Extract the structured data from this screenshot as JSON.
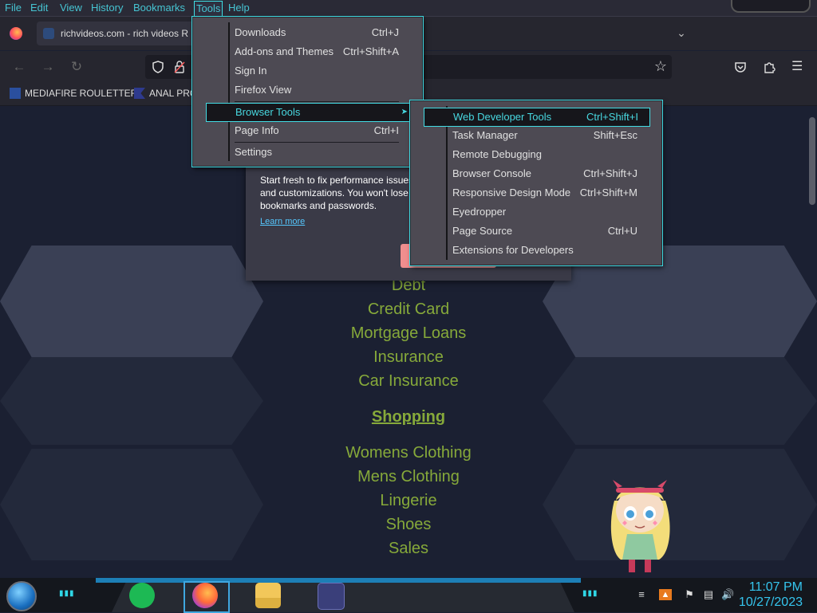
{
  "menubar": {
    "items": [
      "File",
      "Edit",
      "View",
      "History",
      "Bookmarks",
      "Tools",
      "Help"
    ]
  },
  "tab": {
    "title": "richvideos.com - rich videos R"
  },
  "bookmarks": [
    {
      "label": "MEDIAFIRE ROULETTER",
      "icon": "mediafire-icon"
    },
    {
      "label": "ANAL PRO",
      "icon": "bookmark-icon"
    }
  ],
  "popup": {
    "text": "Start fresh to fix performance issues and customizations. You won't lose bookmarks and passwords.",
    "link": "Learn more"
  },
  "tools_menu": {
    "items": [
      {
        "label": "Downloads",
        "shortcut": "Ctrl+J"
      },
      {
        "label": "Add-ons and Themes",
        "shortcut": "Ctrl+Shift+A"
      },
      {
        "label": "Sign In",
        "shortcut": ""
      },
      {
        "label": "Firefox View",
        "shortcut": ""
      },
      {
        "label": "Browser Tools",
        "shortcut": ""
      },
      {
        "label": "Page Info",
        "shortcut": "Ctrl+I"
      },
      {
        "label": "Settings",
        "shortcut": ""
      }
    ]
  },
  "browser_tools_menu": {
    "items": [
      {
        "label": "Web Developer Tools",
        "shortcut": "Ctrl+Shift+I"
      },
      {
        "label": "Task Manager",
        "shortcut": "Shift+Esc"
      },
      {
        "label": "Remote Debugging",
        "shortcut": ""
      },
      {
        "label": "Browser Console",
        "shortcut": "Ctrl+Shift+J"
      },
      {
        "label": "Responsive Design Mode",
        "shortcut": "Ctrl+Shift+M"
      },
      {
        "label": "Eyedropper",
        "shortcut": ""
      },
      {
        "label": "Page Source",
        "shortcut": "Ctrl+U"
      },
      {
        "label": "Extensions for Developers",
        "shortcut": ""
      }
    ]
  },
  "content": {
    "links_top": [
      "Debt",
      "Credit Card",
      "Mortgage Loans",
      "Insurance",
      "Car Insurance"
    ],
    "heading": "Shopping",
    "links_bottom": [
      "Womens Clothing",
      "Mens Clothing",
      "Lingerie",
      "Shoes",
      "Sales"
    ]
  },
  "taskbar": {
    "time": "11:07 PM",
    "date": "10/27/2023"
  },
  "colors": {
    "accent_cyan": "#3ee0e6",
    "link_green": "#86a93a",
    "menu_bg": "#4d4a53",
    "clock": "#35c5ee"
  }
}
